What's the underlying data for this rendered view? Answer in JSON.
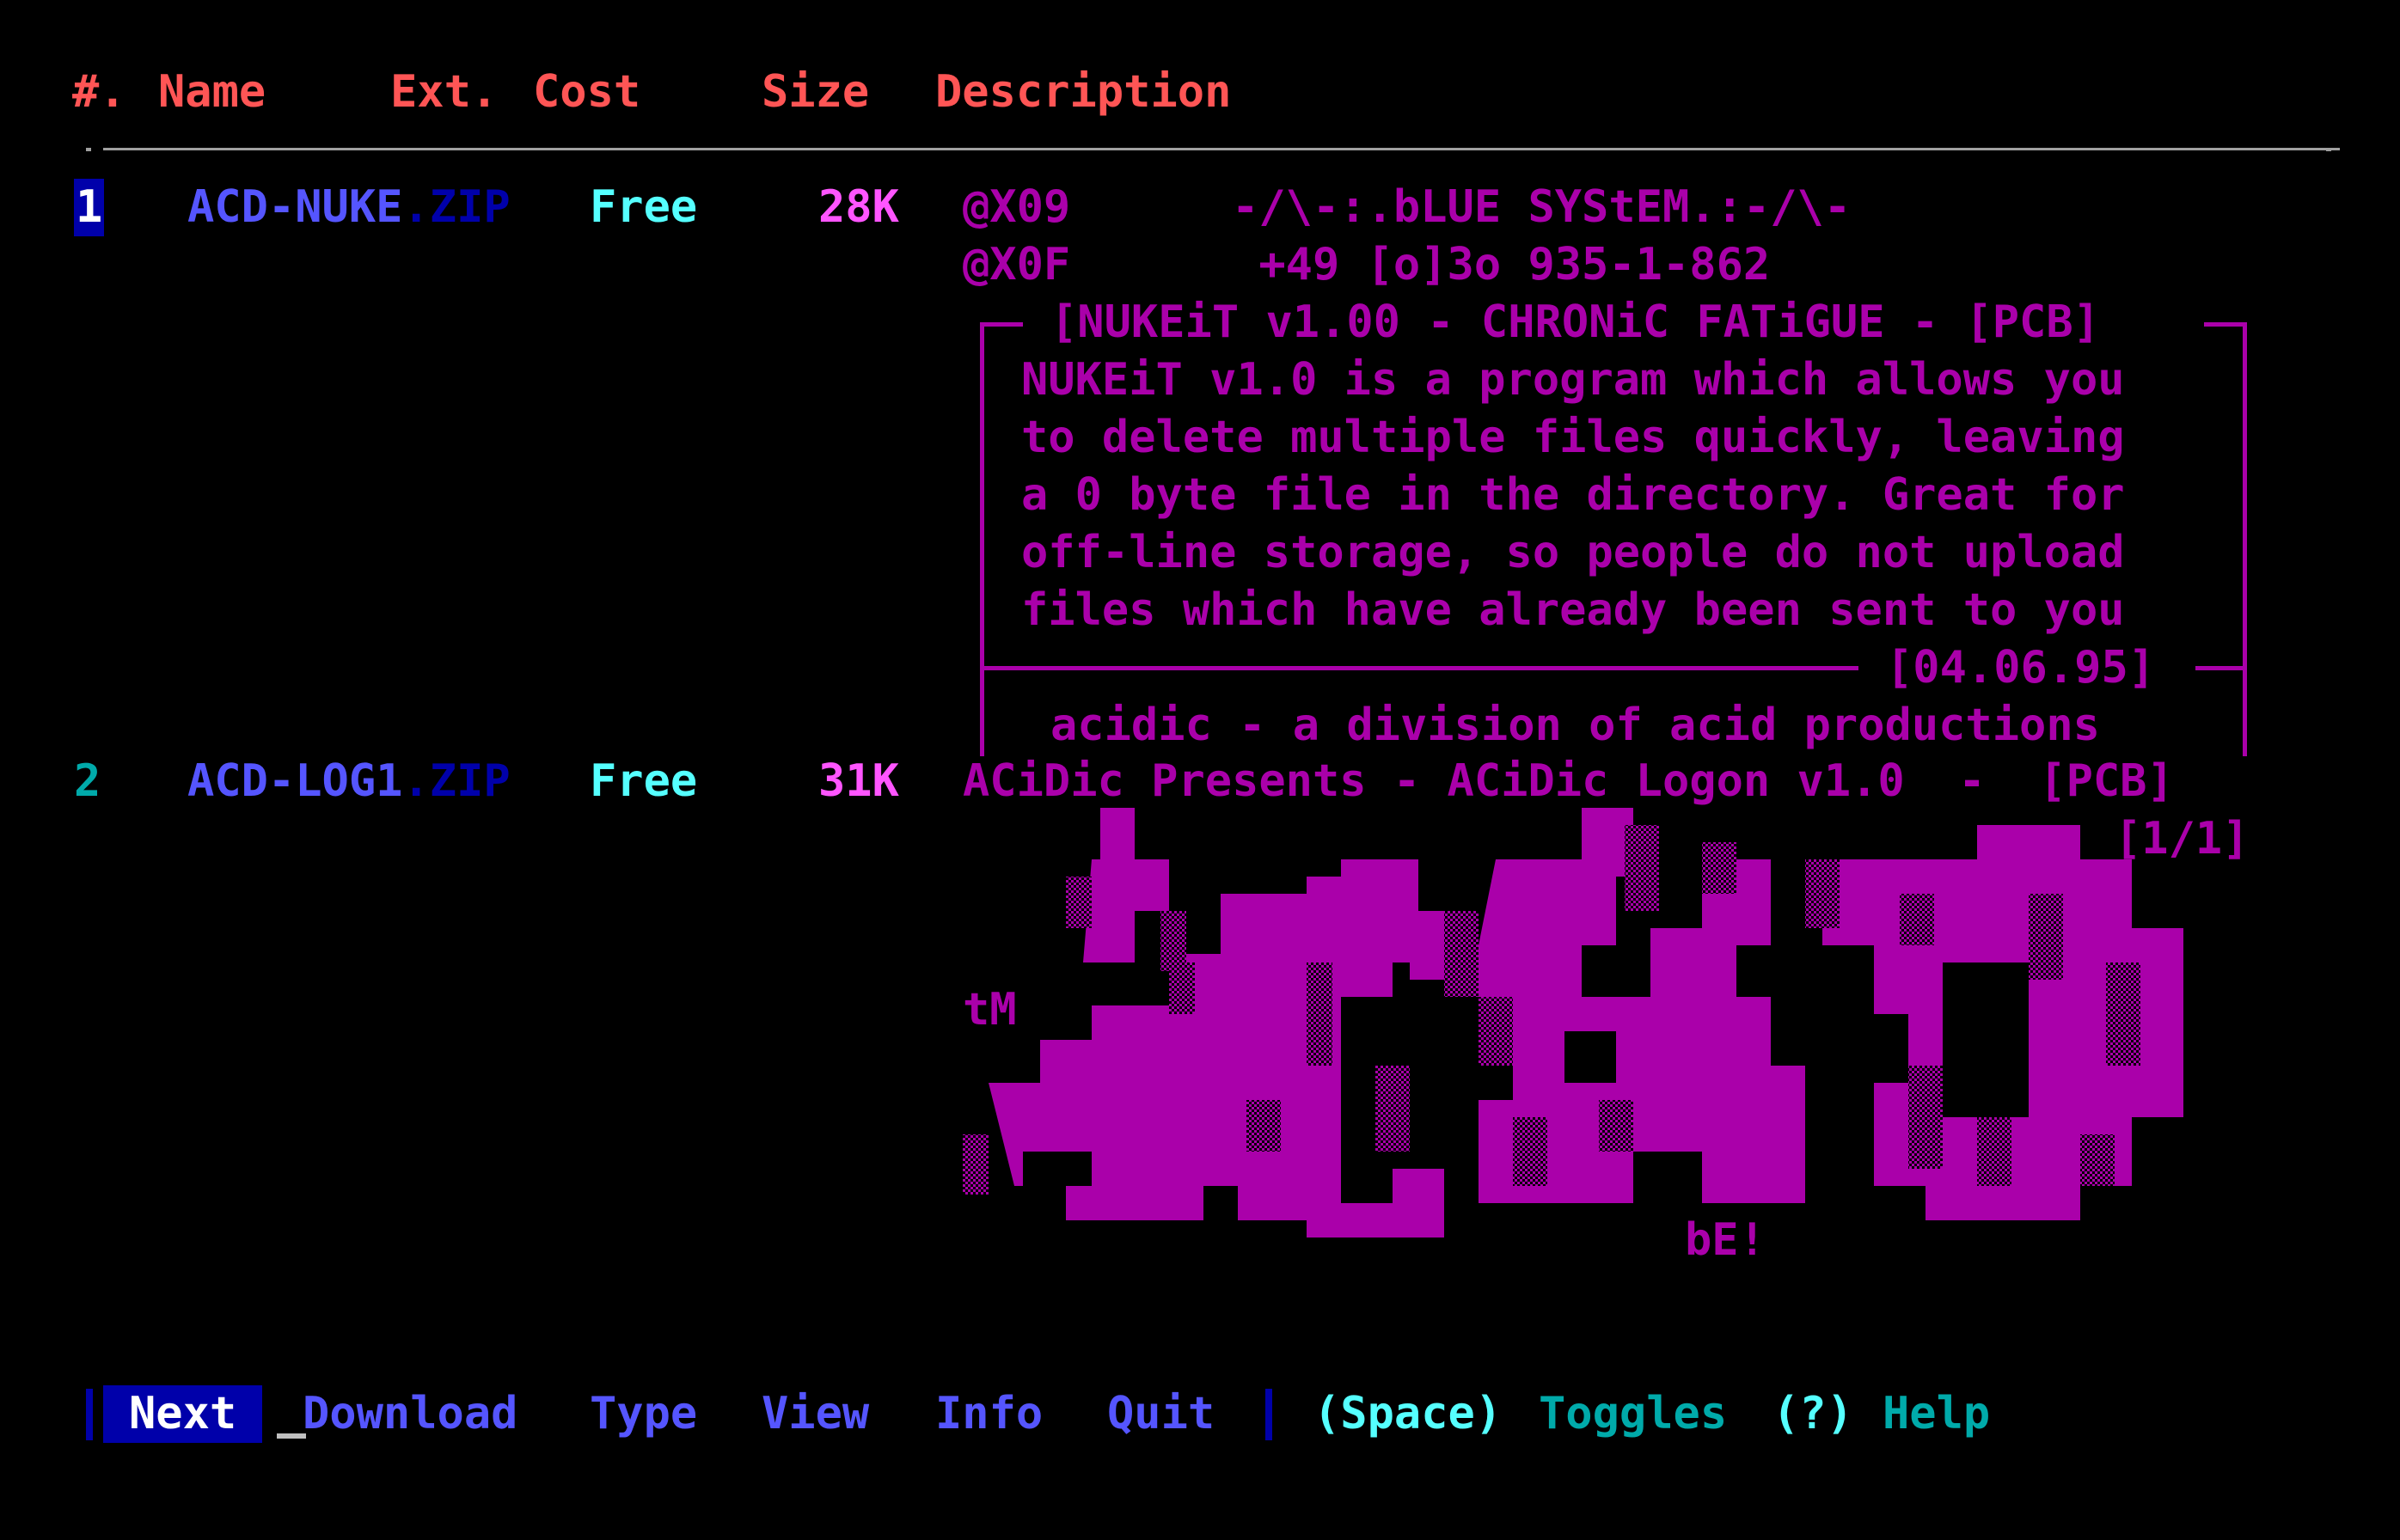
{
  "header": {
    "num": "#.",
    "name": "Name",
    "ext": "Ext.",
    "cost": "Cost",
    "size": "Size",
    "desc": "Description"
  },
  "files": [
    {
      "num": "1",
      "name": "ACD-NUKE",
      "ext": ".ZIP",
      "cost": "Free",
      "size": "28K",
      "desc": [
        "@X09      -/\\-:.bLUE SYStEM.:-/\\-",
        "@X0F       +49 [o]3o 935-1-862"
      ],
      "box_title": "[NUKEiT v1.00 - CHRONiC FATiGUE - [PCB]",
      "box_text": [
        "NUKEiT v1.0 is a program which allows you",
        "to delete multiple files quickly, leaving",
        "a 0 byte file in the directory. Great for",
        "off-line storage, so people do not upload",
        "files which have already been sent to you"
      ],
      "box_date": "[04.06.95]",
      "box_footer": "acidic - a division of acid productions"
    },
    {
      "num": "2",
      "name": "ACD-LOG1",
      "ext": ".ZIP",
      "cost": "Free",
      "size": "31K",
      "desc": [
        "ACiDic Presents - ACiDic Logon v1.0  -  [PCB]",
        "[1/1]"
      ],
      "art_tags": [
        "tM",
        "bE!"
      ]
    }
  ],
  "menu": {
    "next": "Next",
    "download": "Download",
    "type": "Type",
    "view": "View",
    "info": "Info",
    "quit": "Quit"
  },
  "help": {
    "space_key": "(Space)",
    "space_label": "Toggles",
    "help_key": "(?)",
    "help_label": "Help"
  },
  "colors": {
    "background": "#000000",
    "header": "#ff5555",
    "accent_magenta": "#aa00aa",
    "menu_blue": "#5555ff",
    "highlight_bg": "#0000aa"
  }
}
